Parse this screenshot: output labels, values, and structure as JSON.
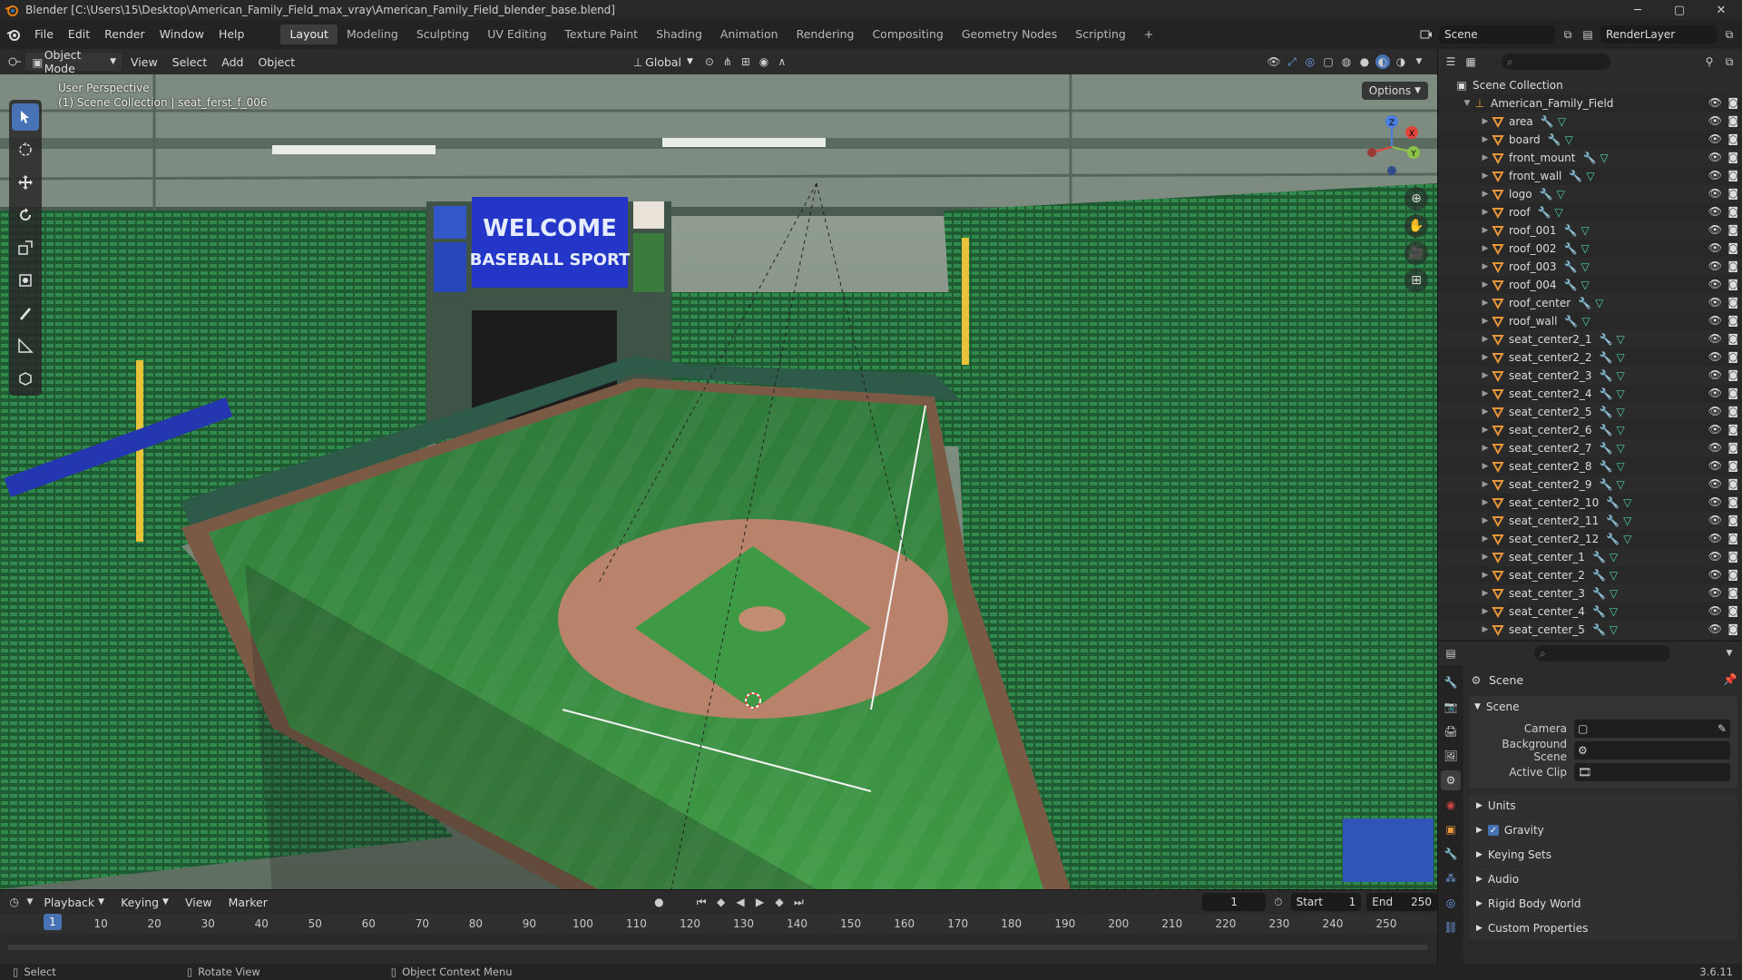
{
  "titlebar": {
    "title": "Blender [C:\\Users\\15\\Desktop\\American_Family_Field_max_vray\\American_Family_Field_blender_base.blend]",
    "minimize": "─",
    "maximize": "▢",
    "close": "✕"
  },
  "menu": [
    "File",
    "Edit",
    "Render",
    "Window",
    "Help"
  ],
  "workspaces": [
    "Layout",
    "Modeling",
    "Sculpting",
    "UV Editing",
    "Texture Paint",
    "Shading",
    "Animation",
    "Rendering",
    "Compositing",
    "Geometry Nodes",
    "Scripting"
  ],
  "workspace_add": "+",
  "active_workspace": "Layout",
  "scene_name": "Scene",
  "view_layer": "RenderLayer",
  "viewport": {
    "mode": "Object Mode",
    "menus": [
      "View",
      "Select",
      "Add",
      "Object"
    ],
    "transform_orientation": "Global",
    "perspective_label": "User Perspective",
    "context_label": "(1) Scene Collection | seat_ferst_f_006",
    "options_label": "Options",
    "scoreboard_line1": "WELCOME",
    "scoreboard_line2": "BASEBALL SPORT"
  },
  "outliner": {
    "root": "Scene Collection",
    "collection": "American_Family_Field",
    "objects": [
      "area",
      "board",
      "front_mount",
      "front_wall",
      "logo",
      "roof",
      "roof_001",
      "roof_002",
      "roof_003",
      "roof_004",
      "roof_center",
      "roof_wall",
      "seat_center2_1",
      "seat_center2_2",
      "seat_center2_3",
      "seat_center2_4",
      "seat_center2_5",
      "seat_center2_6",
      "seat_center2_7",
      "seat_center2_8",
      "seat_center2_9",
      "seat_center2_10",
      "seat_center2_11",
      "seat_center2_12",
      "seat_center_1",
      "seat_center_2",
      "seat_center_3",
      "seat_center_4",
      "seat_center_5"
    ]
  },
  "properties": {
    "context": "Scene",
    "panel_title": "Scene",
    "camera_label": "Camera",
    "background_scene_label": "Background Scene",
    "active_clip_label": "Active Clip",
    "subpanels": [
      "Units",
      "Gravity",
      "Keying Sets",
      "Audio",
      "Rigid Body World",
      "Custom Properties"
    ]
  },
  "timeline": {
    "menus": [
      "Playback",
      "Keying",
      "View",
      "Marker"
    ],
    "current_frame": "1",
    "start_label": "Start",
    "start": "1",
    "end_label": "End",
    "end": "250",
    "ticks": [
      "10",
      "20",
      "30",
      "40",
      "50",
      "60",
      "70",
      "80",
      "90",
      "100",
      "110",
      "120",
      "130",
      "140",
      "150",
      "160",
      "170",
      "180",
      "190",
      "200",
      "210",
      "220",
      "230",
      "240",
      "250"
    ],
    "playhead": "1"
  },
  "statusbar": {
    "select": "Select",
    "rotate": "Rotate View",
    "context_menu": "Object Context Menu",
    "version": "3.6.11"
  },
  "colors": {
    "accent": "#4772b3",
    "object_icon": "#e8973a",
    "modifier_icon": "#6fa0e8",
    "mesh_icon": "#4fd1a2",
    "grass": "#3f8a3a",
    "seats": "#2e7d46"
  }
}
